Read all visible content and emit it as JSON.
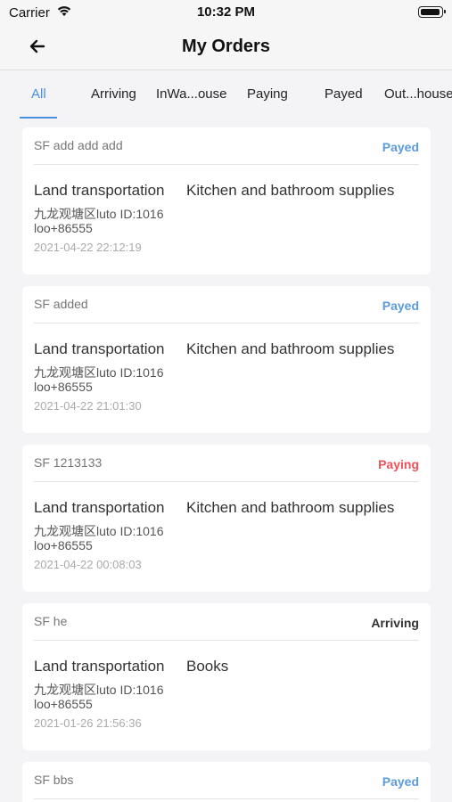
{
  "status_bar": {
    "carrier": "Carrier",
    "time": "10:32 PM"
  },
  "nav": {
    "title": "My Orders"
  },
  "tabs": [
    {
      "label": "All"
    },
    {
      "label": "Arriving"
    },
    {
      "label": "InWa...ouse"
    },
    {
      "label": "Paying"
    },
    {
      "label": "Payed"
    },
    {
      "label": "Out...house"
    }
  ],
  "orders": [
    {
      "sf": "SF add add add",
      "status": "Payed",
      "type": "Land transportation",
      "goods": "Kitchen and bathroom supplies",
      "address": "九龙观塘区luto ID:1016",
      "phone": "loo+86555",
      "time": "2021-04-22 22:12:19"
    },
    {
      "sf": "SF added",
      "status": "Payed",
      "type": "Land transportation",
      "goods": "Kitchen and bathroom supplies",
      "address": "九龙观塘区luto ID:1016",
      "phone": "loo+86555",
      "time": "2021-04-22 21:01:30"
    },
    {
      "sf": "SF 1213133",
      "status": "Paying",
      "type": "Land transportation",
      "goods": "Kitchen and bathroom supplies",
      "address": "九龙观塘区luto ID:1016",
      "phone": "loo+86555",
      "time": "2021-04-22 00:08:03"
    },
    {
      "sf": "SF he",
      "status": "Arriving",
      "type": "Land transportation",
      "goods": "Books",
      "address": "九龙观塘区luto ID:1016",
      "phone": "loo+86555",
      "time": "2021-01-26 21:56:36"
    },
    {
      "sf": "SF bbs",
      "status": "Payed"
    }
  ]
}
